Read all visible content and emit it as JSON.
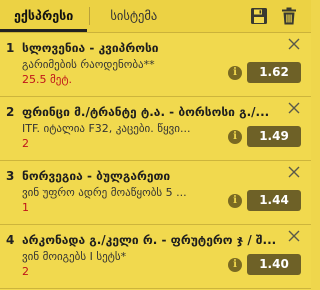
{
  "tabs": [
    {
      "label": "ექსპრესი"
    },
    {
      "label": "სისტემა"
    }
  ],
  "icons": {
    "save": "save-icon",
    "trash": "trash-icon",
    "close": "close-icon",
    "info": "info-icon"
  },
  "bets": [
    {
      "index": "1",
      "title": "სლოვენია - კვიპროსი",
      "market": "გარიმების რაოდენობა**",
      "pick": "25.5 მეტ.",
      "odds": "1.62"
    },
    {
      "index": "2",
      "title": "ფრინცი მ./ტრანტე ტ.ა. - ბორსოსი გ./...",
      "market": "ITF. იტალია F32, კაცები. წყვი...",
      "pick": "2",
      "odds": "1.49"
    },
    {
      "index": "3",
      "title": "ნორვეგია - ბულგარეთი",
      "market": "ვინ უფრო ადრე მოაწყობს 5 ...",
      "pick": "1",
      "odds": "1.44"
    },
    {
      "index": "4",
      "title": "არკონადა გ./კელი რ. - ფრუტერო ჯ / შ...",
      "market": "ვინ მოიგებს I სეტს*",
      "pick": "2",
      "odds": "1.40"
    }
  ],
  "colors": {
    "background": "#f1d94e",
    "odds_bg": "#6e6127",
    "pick_red": "#c0141a"
  }
}
